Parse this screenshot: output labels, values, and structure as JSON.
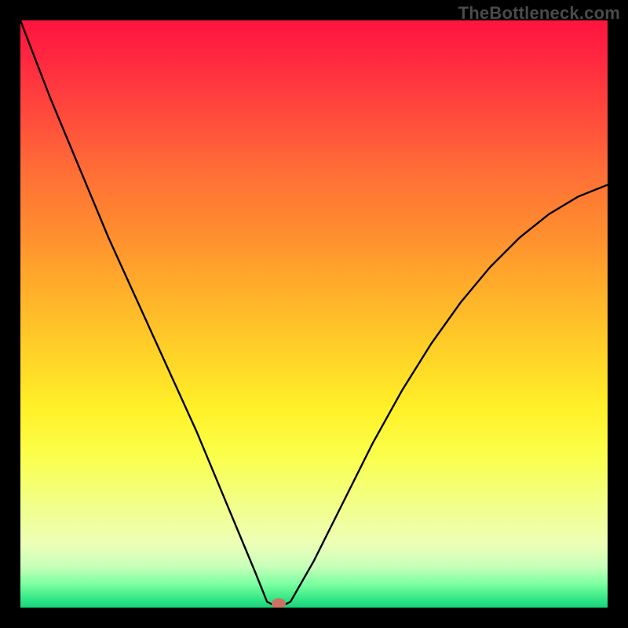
{
  "watermark": "TheBottleneck.com",
  "marker": {
    "x_pct": 44.0,
    "y_pct": 99.3,
    "color": "#cb7465"
  },
  "chart_data": {
    "type": "line",
    "title": "",
    "xlabel": "",
    "ylabel": "",
    "xlim": [
      0,
      100
    ],
    "ylim": [
      0,
      100
    ],
    "series": [
      {
        "name": "bottleneck-curve",
        "x": [
          0,
          5,
          10,
          15,
          20,
          25,
          30,
          35,
          40,
          42,
          44,
          46,
          50,
          55,
          60,
          65,
          70,
          75,
          80,
          85,
          90,
          95,
          100
        ],
        "y": [
          100,
          87,
          75,
          63,
          52,
          41,
          30,
          18,
          6,
          1,
          0,
          1,
          8,
          18,
          28,
          37,
          45,
          52,
          58,
          63,
          67,
          70,
          72
        ]
      }
    ],
    "annotations": [
      {
        "type": "marker",
        "x": 44,
        "y": 0.7,
        "label": "optimal-point"
      }
    ],
    "background_gradient": {
      "direction": "vertical",
      "stops": [
        {
          "pct": 0,
          "color": "#ff143f"
        },
        {
          "pct": 50,
          "color": "#ffc228"
        },
        {
          "pct": 75,
          "color": "#fbff50"
        },
        {
          "pct": 100,
          "color": "#17d47a"
        }
      ]
    }
  }
}
